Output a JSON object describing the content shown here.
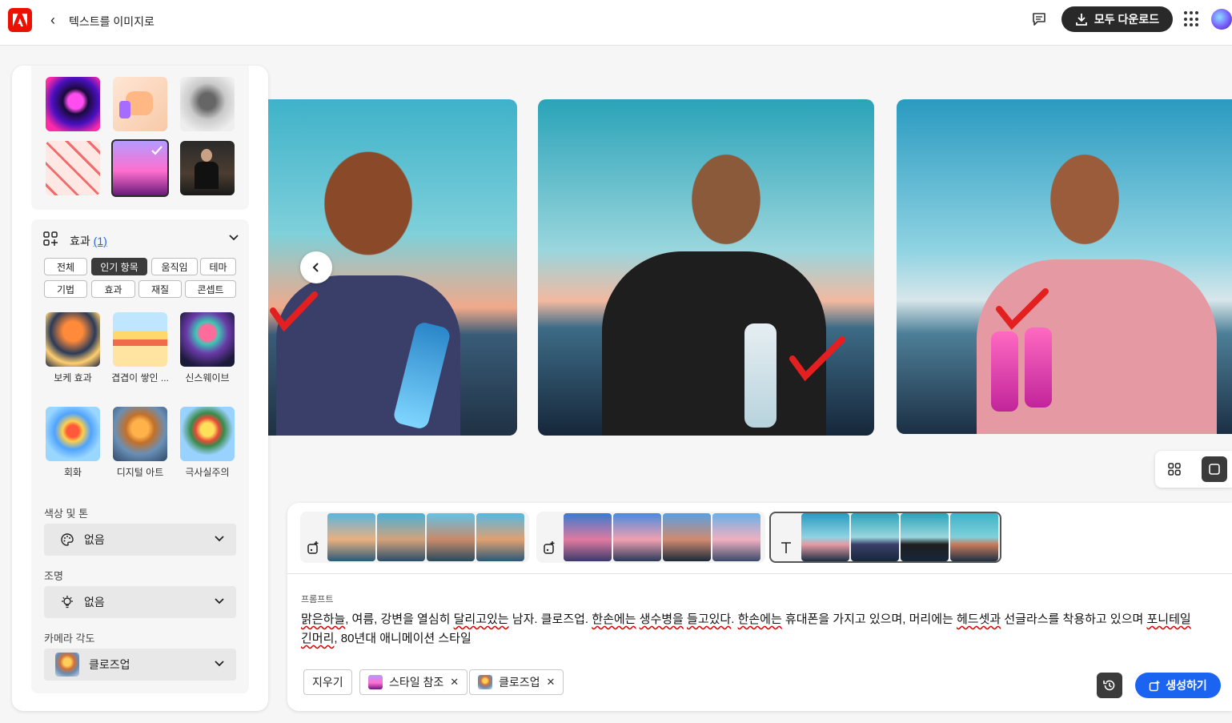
{
  "header": {
    "title": "텍스트를 이미지로",
    "download_all_label": "모두 다운로드"
  },
  "effects": {
    "heading": "효과",
    "count": "(1)",
    "filters": [
      "전체",
      "인기 항목",
      "움직임",
      "테마",
      "기법",
      "효과",
      "재질",
      "콘셉트"
    ],
    "selected_filter": "인기 항목",
    "items": [
      {
        "label": "보케 효과"
      },
      {
        "label": "겹겹이 쌓인 ..."
      },
      {
        "label": "신스웨이브"
      },
      {
        "label": "회화"
      },
      {
        "label": "디지털 아트"
      },
      {
        "label": "극사실주의"
      }
    ]
  },
  "color_tone": {
    "label": "색상 및 톤",
    "value": "없음"
  },
  "lighting": {
    "label": "조명",
    "value": "없음"
  },
  "camera_angle": {
    "label": "카메라 각도",
    "value": "클로즈업"
  },
  "prompt": {
    "label": "프롬프트",
    "segments": [
      {
        "t": "맑은하늘",
        "err": true
      },
      {
        "t": ", 여름, 강변을 열심히 ",
        "err": false
      },
      {
        "t": "달리고있는",
        "err": true
      },
      {
        "t": " 남자. 클로즈업. ",
        "err": false
      },
      {
        "t": "한손에는",
        "err": true
      },
      {
        "t": " ",
        "err": false
      },
      {
        "t": "생수병을",
        "err": true
      },
      {
        "t": " ",
        "err": false
      },
      {
        "t": "들고있다",
        "err": true
      },
      {
        "t": ". ",
        "err": false
      },
      {
        "t": "한손에는",
        "err": true
      },
      {
        "t": " 휴대폰을 가지고 있으며, 머리에는 ",
        "err": false
      },
      {
        "t": "헤드셋과",
        "err": true
      },
      {
        "t": " 선글라스를 착용하고 있으며 ",
        "err": false
      },
      {
        "t": "포니테일",
        "err": true
      },
      {
        "t": " ",
        "err": false
      },
      {
        "t": "긴머리",
        "err": true
      },
      {
        "t": ", 80년대 애니메이션 스타일",
        "err": false
      }
    ]
  },
  "tags": {
    "clear_label": "지우기",
    "style_ref_label": "스타일 참조",
    "closeup_label": "클로즈업"
  },
  "generate_label": "생성하기",
  "colors": {
    "accent": "#1b64f2",
    "brand": "#eb1000",
    "dark": "#292929"
  }
}
